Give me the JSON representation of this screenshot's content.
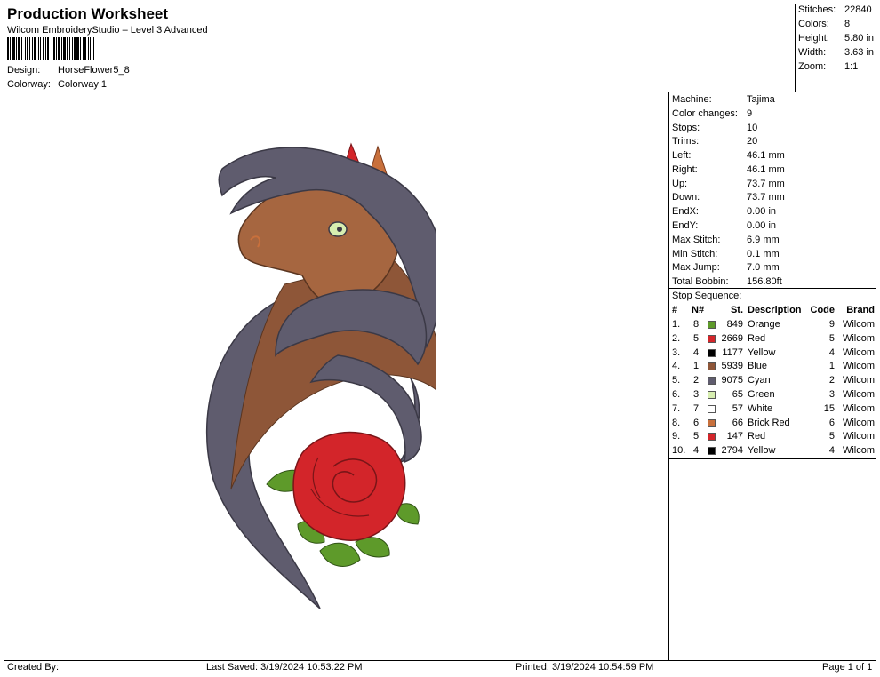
{
  "header": {
    "title": "Production Worksheet",
    "software": "Wilcom EmbroideryStudio – Level 3 Advanced",
    "design_label": "Design:",
    "design_value": "HorseFlower5_8",
    "colorway_label": "Colorway:",
    "colorway_value": "Colorway 1"
  },
  "stats": [
    {
      "k": "Stitches:",
      "v": "22840"
    },
    {
      "k": "Colors:",
      "v": "8"
    },
    {
      "k": "Height:",
      "v": "5.80 in"
    },
    {
      "k": "Width:",
      "v": "3.63 in"
    },
    {
      "k": "Zoom:",
      "v": "1:1"
    }
  ],
  "machine_info": [
    {
      "k": "Machine:",
      "v": "Tajima"
    },
    {
      "k": "Color changes:",
      "v": "9"
    },
    {
      "k": "Stops:",
      "v": "10"
    },
    {
      "k": "Trims:",
      "v": "20"
    },
    {
      "k": "Left:",
      "v": "46.1 mm"
    },
    {
      "k": "Right:",
      "v": "46.1 mm"
    },
    {
      "k": "Up:",
      "v": "73.7 mm"
    },
    {
      "k": "Down:",
      "v": "73.7 mm"
    },
    {
      "k": "EndX:",
      "v": "0.00 in"
    },
    {
      "k": "EndY:",
      "v": "0.00 in"
    },
    {
      "k": "Max Stitch:",
      "v": "6.9 mm"
    },
    {
      "k": "Min Stitch:",
      "v": "0.1 mm"
    },
    {
      "k": "Max Jump:",
      "v": "7.0 mm"
    },
    {
      "k": "Total Bobbin:",
      "v": "156.80ft"
    }
  ],
  "stop_sequence": {
    "title": "Stop Sequence:",
    "headers": {
      "idx": "#",
      "n": "N#",
      "st": "St.",
      "desc": "Description",
      "code": "Code",
      "brand": "Brand"
    },
    "rows": [
      {
        "idx": "1.",
        "n": "8",
        "color": "#5e9a2a",
        "st": "849",
        "desc": "Orange",
        "code": "9",
        "brand": "Wilcom"
      },
      {
        "idx": "2.",
        "n": "5",
        "color": "#d3252a",
        "st": "2669",
        "desc": "Red",
        "code": "5",
        "brand": "Wilcom"
      },
      {
        "idx": "3.",
        "n": "4",
        "color": "#000000",
        "st": "1177",
        "desc": "Yellow",
        "code": "4",
        "brand": "Wilcom"
      },
      {
        "idx": "4.",
        "n": "1",
        "color": "#8e5638",
        "st": "5939",
        "desc": "Blue",
        "code": "1",
        "brand": "Wilcom"
      },
      {
        "idx": "5.",
        "n": "2",
        "color": "#5f5c6e",
        "st": "9075",
        "desc": "Cyan",
        "code": "2",
        "brand": "Wilcom"
      },
      {
        "idx": "6.",
        "n": "3",
        "color": "#d7eeb0",
        "st": "65",
        "desc": "Green",
        "code": "3",
        "brand": "Wilcom"
      },
      {
        "idx": "7.",
        "n": "7",
        "color": "#ffffff",
        "st": "57",
        "desc": "White",
        "code": "15",
        "brand": "Wilcom"
      },
      {
        "idx": "8.",
        "n": "6",
        "color": "#c8703c",
        "st": "66",
        "desc": "Brick Red",
        "code": "6",
        "brand": "Wilcom"
      },
      {
        "idx": "9.",
        "n": "5",
        "color": "#d3252a",
        "st": "147",
        "desc": "Red",
        "code": "5",
        "brand": "Wilcom"
      },
      {
        "idx": "10.",
        "n": "4",
        "color": "#000000",
        "st": "2794",
        "desc": "Yellow",
        "code": "4",
        "brand": "Wilcom"
      }
    ]
  },
  "footer": {
    "created_by": "Created By:",
    "last_saved": "Last Saved: 3/19/2024 10:53:22 PM",
    "printed": "Printed: 3/19/2024 10:54:59 PM",
    "page": "Page 1 of 1"
  }
}
